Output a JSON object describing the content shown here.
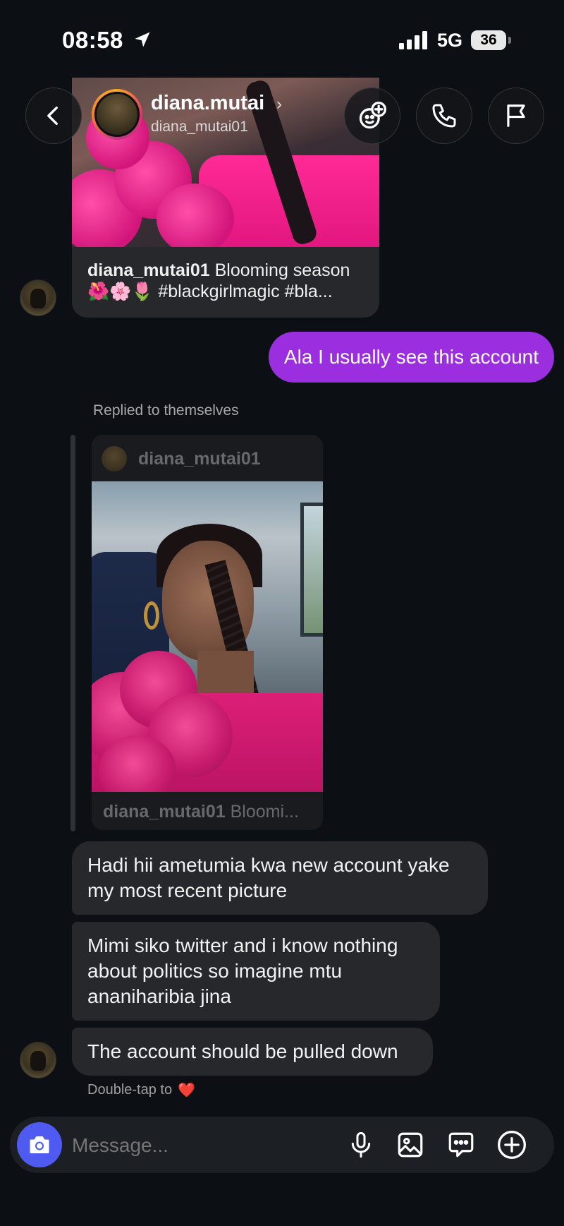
{
  "status_bar": {
    "time": "08:58",
    "network": "5G",
    "battery": "36"
  },
  "header": {
    "display_name": "diana.mutai",
    "chevron": "›",
    "username": "diana_mutai01"
  },
  "shared_post": {
    "user": "diana_mutai01",
    "caption_line1": " Blooming season",
    "caption_line2": "🌺🌸🌷 #blackgirlmagic #bla..."
  },
  "outgoing_message": "Ala I usually see this account",
  "reply_note": "Replied to themselves",
  "quoted_post": {
    "username": "diana_mutai01",
    "caption_user": "diana_mutai01",
    "caption_text": " Bloomi..."
  },
  "incoming_messages": [
    "Hadi hii ametumia kwa new account yake my most recent picture",
    "Mimi siko twitter and i know nothing about politics so imagine mtu ananiharibia jina",
    "The account should be pulled down"
  ],
  "double_tap": {
    "text": "Double-tap to",
    "heart": "❤️"
  },
  "composer": {
    "placeholder": "Message..."
  },
  "colors": {
    "background": "#0c1014",
    "outgoing_bubble": "#9b2fe0",
    "incoming_bubble": "#26282c",
    "camera_button": "#4f5bf0"
  },
  "icons": [
    "location-arrow-icon",
    "signal-icon",
    "back-icon",
    "add-friends-icon",
    "phone-icon",
    "flag-icon",
    "camera-icon",
    "mic-icon",
    "image-icon",
    "sticker-icon",
    "plus-icon"
  ]
}
